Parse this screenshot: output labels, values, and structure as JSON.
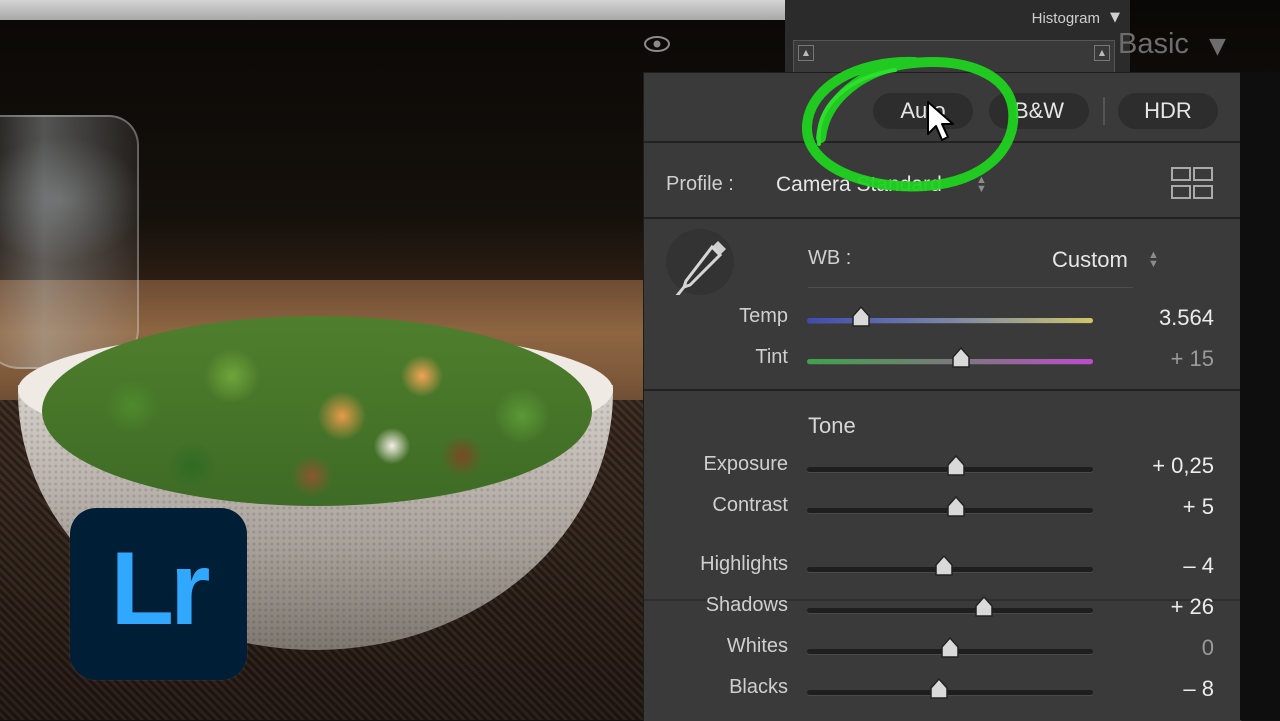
{
  "header": {
    "histogram_label": "Histogram",
    "panel_title": "Basic"
  },
  "treatment": {
    "auto_label": "Auto",
    "bw_label": "B&W",
    "hdr_label": "HDR"
  },
  "profile": {
    "label": "Profile :",
    "value": "Camera Standard"
  },
  "white_balance": {
    "label": "WB :",
    "value": "Custom",
    "sliders": [
      {
        "label": "Temp",
        "value": "3.564",
        "position": 0.19
      },
      {
        "label": "Tint",
        "value": "+ 15",
        "position": 0.54,
        "dim": true
      }
    ]
  },
  "tone": {
    "title": "Tone",
    "sliders": [
      {
        "label": "Exposure",
        "value": "+ 0,25",
        "position": 0.52
      },
      {
        "label": "Contrast",
        "value": "+ 5",
        "position": 0.52
      },
      {
        "label": "Highlights",
        "value": "– 4",
        "position": 0.48
      },
      {
        "label": "Shadows",
        "value": "+ 26",
        "position": 0.62
      },
      {
        "label": "Whites",
        "value": "0",
        "position": 0.5,
        "dim": true
      },
      {
        "label": "Blacks",
        "value": "– 8",
        "position": 0.46
      }
    ]
  },
  "logo": {
    "text": "Lr",
    "bg": "#001e36",
    "fg": "#31a8ff"
  },
  "colors": {
    "panel_bg": "#3a3a3a",
    "highlight_circle": "#1fd21f"
  }
}
